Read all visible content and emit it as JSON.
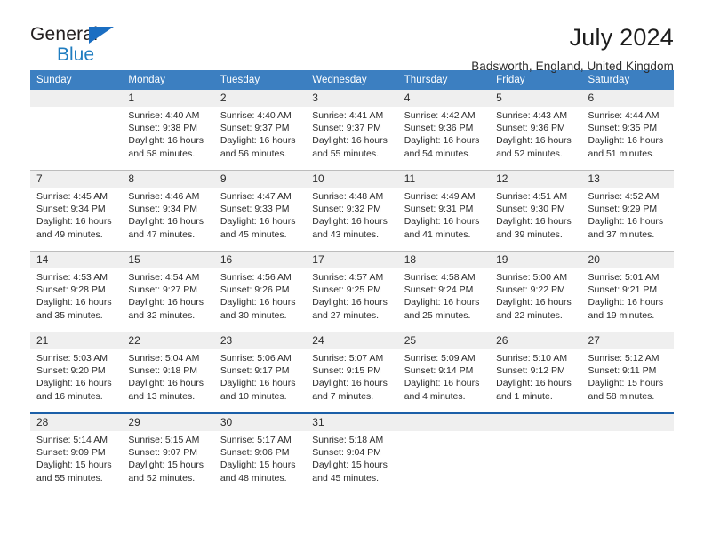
{
  "brand": {
    "name_part1": "General",
    "name_part2": "Blue",
    "flag_icon": "triangle-flag-icon"
  },
  "header": {
    "title": "July 2024",
    "location": "Badsworth, England, United Kingdom"
  },
  "theme": {
    "header_blue": "#3c7fc1",
    "band_gray": "#efefef",
    "rule_blue": "#1b5fa8",
    "brand_blue": "#1f7dc0"
  },
  "weekdays": [
    "Sunday",
    "Monday",
    "Tuesday",
    "Wednesday",
    "Thursday",
    "Friday",
    "Saturday"
  ],
  "weeks": [
    [
      {
        "day": "",
        "lines": [
          "",
          "",
          "",
          ""
        ]
      },
      {
        "day": "1",
        "lines": [
          "Sunrise: 4:40 AM",
          "Sunset: 9:38 PM",
          "Daylight: 16 hours",
          "and 58 minutes."
        ]
      },
      {
        "day": "2",
        "lines": [
          "Sunrise: 4:40 AM",
          "Sunset: 9:37 PM",
          "Daylight: 16 hours",
          "and 56 minutes."
        ]
      },
      {
        "day": "3",
        "lines": [
          "Sunrise: 4:41 AM",
          "Sunset: 9:37 PM",
          "Daylight: 16 hours",
          "and 55 minutes."
        ]
      },
      {
        "day": "4",
        "lines": [
          "Sunrise: 4:42 AM",
          "Sunset: 9:36 PM",
          "Daylight: 16 hours",
          "and 54 minutes."
        ]
      },
      {
        "day": "5",
        "lines": [
          "Sunrise: 4:43 AM",
          "Sunset: 9:36 PM",
          "Daylight: 16 hours",
          "and 52 minutes."
        ]
      },
      {
        "day": "6",
        "lines": [
          "Sunrise: 4:44 AM",
          "Sunset: 9:35 PM",
          "Daylight: 16 hours",
          "and 51 minutes."
        ]
      }
    ],
    [
      {
        "day": "7",
        "lines": [
          "Sunrise: 4:45 AM",
          "Sunset: 9:34 PM",
          "Daylight: 16 hours",
          "and 49 minutes."
        ]
      },
      {
        "day": "8",
        "lines": [
          "Sunrise: 4:46 AM",
          "Sunset: 9:34 PM",
          "Daylight: 16 hours",
          "and 47 minutes."
        ]
      },
      {
        "day": "9",
        "lines": [
          "Sunrise: 4:47 AM",
          "Sunset: 9:33 PM",
          "Daylight: 16 hours",
          "and 45 minutes."
        ]
      },
      {
        "day": "10",
        "lines": [
          "Sunrise: 4:48 AM",
          "Sunset: 9:32 PM",
          "Daylight: 16 hours",
          "and 43 minutes."
        ]
      },
      {
        "day": "11",
        "lines": [
          "Sunrise: 4:49 AM",
          "Sunset: 9:31 PM",
          "Daylight: 16 hours",
          "and 41 minutes."
        ]
      },
      {
        "day": "12",
        "lines": [
          "Sunrise: 4:51 AM",
          "Sunset: 9:30 PM",
          "Daylight: 16 hours",
          "and 39 minutes."
        ]
      },
      {
        "day": "13",
        "lines": [
          "Sunrise: 4:52 AM",
          "Sunset: 9:29 PM",
          "Daylight: 16 hours",
          "and 37 minutes."
        ]
      }
    ],
    [
      {
        "day": "14",
        "lines": [
          "Sunrise: 4:53 AM",
          "Sunset: 9:28 PM",
          "Daylight: 16 hours",
          "and 35 minutes."
        ]
      },
      {
        "day": "15",
        "lines": [
          "Sunrise: 4:54 AM",
          "Sunset: 9:27 PM",
          "Daylight: 16 hours",
          "and 32 minutes."
        ]
      },
      {
        "day": "16",
        "lines": [
          "Sunrise: 4:56 AM",
          "Sunset: 9:26 PM",
          "Daylight: 16 hours",
          "and 30 minutes."
        ]
      },
      {
        "day": "17",
        "lines": [
          "Sunrise: 4:57 AM",
          "Sunset: 9:25 PM",
          "Daylight: 16 hours",
          "and 27 minutes."
        ]
      },
      {
        "day": "18",
        "lines": [
          "Sunrise: 4:58 AM",
          "Sunset: 9:24 PM",
          "Daylight: 16 hours",
          "and 25 minutes."
        ]
      },
      {
        "day": "19",
        "lines": [
          "Sunrise: 5:00 AM",
          "Sunset: 9:22 PM",
          "Daylight: 16 hours",
          "and 22 minutes."
        ]
      },
      {
        "day": "20",
        "lines": [
          "Sunrise: 5:01 AM",
          "Sunset: 9:21 PM",
          "Daylight: 16 hours",
          "and 19 minutes."
        ]
      }
    ],
    [
      {
        "day": "21",
        "lines": [
          "Sunrise: 5:03 AM",
          "Sunset: 9:20 PM",
          "Daylight: 16 hours",
          "and 16 minutes."
        ]
      },
      {
        "day": "22",
        "lines": [
          "Sunrise: 5:04 AM",
          "Sunset: 9:18 PM",
          "Daylight: 16 hours",
          "and 13 minutes."
        ]
      },
      {
        "day": "23",
        "lines": [
          "Sunrise: 5:06 AM",
          "Sunset: 9:17 PM",
          "Daylight: 16 hours",
          "and 10 minutes."
        ]
      },
      {
        "day": "24",
        "lines": [
          "Sunrise: 5:07 AM",
          "Sunset: 9:15 PM",
          "Daylight: 16 hours",
          "and 7 minutes."
        ]
      },
      {
        "day": "25",
        "lines": [
          "Sunrise: 5:09 AM",
          "Sunset: 9:14 PM",
          "Daylight: 16 hours",
          "and 4 minutes."
        ]
      },
      {
        "day": "26",
        "lines": [
          "Sunrise: 5:10 AM",
          "Sunset: 9:12 PM",
          "Daylight: 16 hours",
          "and 1 minute."
        ]
      },
      {
        "day": "27",
        "lines": [
          "Sunrise: 5:12 AM",
          "Sunset: 9:11 PM",
          "Daylight: 15 hours",
          "and 58 minutes."
        ]
      }
    ],
    [
      {
        "day": "28",
        "lines": [
          "Sunrise: 5:14 AM",
          "Sunset: 9:09 PM",
          "Daylight: 15 hours",
          "and 55 minutes."
        ]
      },
      {
        "day": "29",
        "lines": [
          "Sunrise: 5:15 AM",
          "Sunset: 9:07 PM",
          "Daylight: 15 hours",
          "and 52 minutes."
        ]
      },
      {
        "day": "30",
        "lines": [
          "Sunrise: 5:17 AM",
          "Sunset: 9:06 PM",
          "Daylight: 15 hours",
          "and 48 minutes."
        ]
      },
      {
        "day": "31",
        "lines": [
          "Sunrise: 5:18 AM",
          "Sunset: 9:04 PM",
          "Daylight: 15 hours",
          "and 45 minutes."
        ]
      },
      {
        "day": "",
        "lines": [
          "",
          "",
          "",
          ""
        ]
      },
      {
        "day": "",
        "lines": [
          "",
          "",
          "",
          ""
        ]
      },
      {
        "day": "",
        "lines": [
          "",
          "",
          "",
          ""
        ]
      }
    ]
  ]
}
